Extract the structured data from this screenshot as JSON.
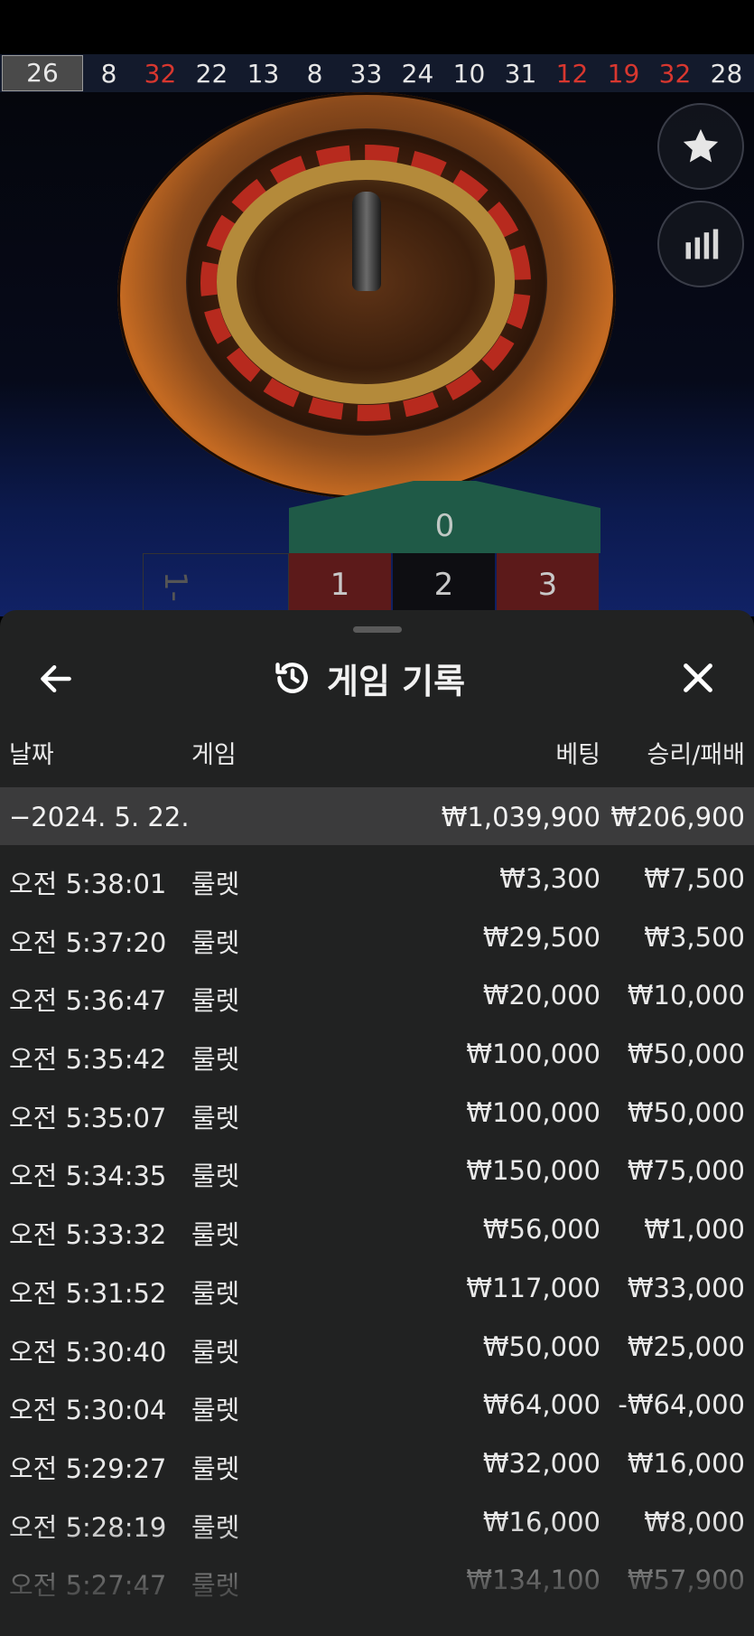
{
  "history_strip": [
    {
      "n": "26",
      "color": "gray"
    },
    {
      "n": "8",
      "color": "white"
    },
    {
      "n": "32",
      "color": "red"
    },
    {
      "n": "22",
      "color": "white"
    },
    {
      "n": "13",
      "color": "white"
    },
    {
      "n": "8",
      "color": "white"
    },
    {
      "n": "33",
      "color": "white"
    },
    {
      "n": "24",
      "color": "white"
    },
    {
      "n": "10",
      "color": "white"
    },
    {
      "n": "31",
      "color": "white"
    },
    {
      "n": "12",
      "color": "red"
    },
    {
      "n": "19",
      "color": "red"
    },
    {
      "n": "32",
      "color": "red"
    },
    {
      "n": "28",
      "color": "white"
    }
  ],
  "side_buttons": {
    "favorite_icon": "star-icon",
    "stats_icon": "bar-chart-icon"
  },
  "table": {
    "zero": "0",
    "cells": [
      {
        "n": "1",
        "color": "red"
      },
      {
        "n": "2",
        "color": "black"
      },
      {
        "n": "3",
        "color": "red"
      }
    ]
  },
  "sheet": {
    "title": "게임 기록",
    "columns": {
      "date": "날짜",
      "game": "게임",
      "bet": "베팅",
      "result": "승리/패배"
    },
    "date_group": {
      "label": "−2024. 5. 22.",
      "bet": "₩1,039,900",
      "result": "₩206,900"
    },
    "rows": [
      {
        "time": "오전 5:38:01",
        "game": "룰렛",
        "bet": "₩3,300",
        "result": "₩7,500"
      },
      {
        "time": "오전 5:37:20",
        "game": "룰렛",
        "bet": "₩29,500",
        "result": "₩3,500"
      },
      {
        "time": "오전 5:36:47",
        "game": "룰렛",
        "bet": "₩20,000",
        "result": "₩10,000"
      },
      {
        "time": "오전 5:35:42",
        "game": "룰렛",
        "bet": "₩100,000",
        "result": "₩50,000"
      },
      {
        "time": "오전 5:35:07",
        "game": "룰렛",
        "bet": "₩100,000",
        "result": "₩50,000"
      },
      {
        "time": "오전 5:34:35",
        "game": "룰렛",
        "bet": "₩150,000",
        "result": "₩75,000"
      },
      {
        "time": "오전 5:33:32",
        "game": "룰렛",
        "bet": "₩56,000",
        "result": "₩1,000"
      },
      {
        "time": "오전 5:31:52",
        "game": "룰렛",
        "bet": "₩117,000",
        "result": "₩33,000"
      },
      {
        "time": "오전 5:30:40",
        "game": "룰렛",
        "bet": "₩50,000",
        "result": "₩25,000"
      },
      {
        "time": "오전 5:30:04",
        "game": "룰렛",
        "bet": "₩64,000",
        "result": "-₩64,000"
      },
      {
        "time": "오전 5:29:27",
        "game": "룰렛",
        "bet": "₩32,000",
        "result": "₩16,000"
      },
      {
        "time": "오전 5:28:19",
        "game": "룰렛",
        "bet": "₩16,000",
        "result": "₩8,000"
      },
      {
        "time": "오전 5:27:47",
        "game": "룰렛",
        "bet": "₩134,100",
        "result": "₩57,900"
      }
    ]
  }
}
